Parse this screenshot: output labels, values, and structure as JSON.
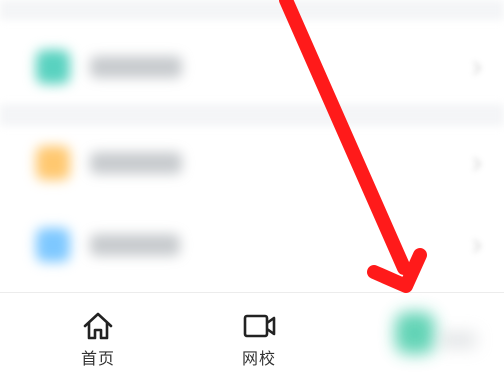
{
  "list": {
    "rows": [
      {
        "icon_color": "#59d2c0"
      },
      {
        "icon_color": "#ffc870"
      },
      {
        "icon_color": "#7ec8ff"
      }
    ]
  },
  "tabbar": {
    "tabs": [
      {
        "label": "首页",
        "icon": "home-icon"
      },
      {
        "label": "网校",
        "icon": "video-camera-icon"
      },
      {
        "label": "",
        "icon": "blurred-tab-icon",
        "icon_color": "#52cfae"
      }
    ]
  },
  "annotation": {
    "arrow_color": "#ff1a1a"
  }
}
